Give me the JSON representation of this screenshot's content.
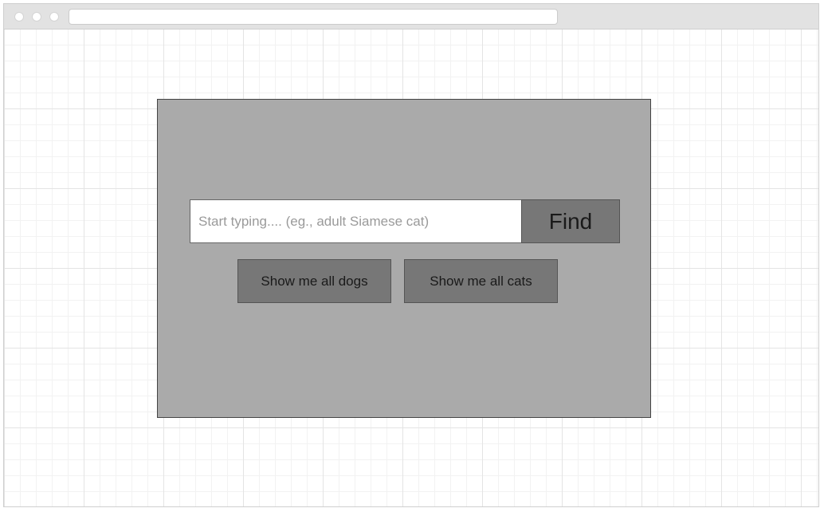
{
  "search": {
    "placeholder": "Start typing.... (eg., adult Siamese cat)",
    "value": "",
    "find_label": "Find"
  },
  "quick_actions": {
    "dogs_label": "Show me all dogs",
    "cats_label": "Show me all cats"
  },
  "colors": {
    "panel_background": "#aaaaaa",
    "button_background": "#777777",
    "titlebar_background": "#e2e2e2"
  }
}
